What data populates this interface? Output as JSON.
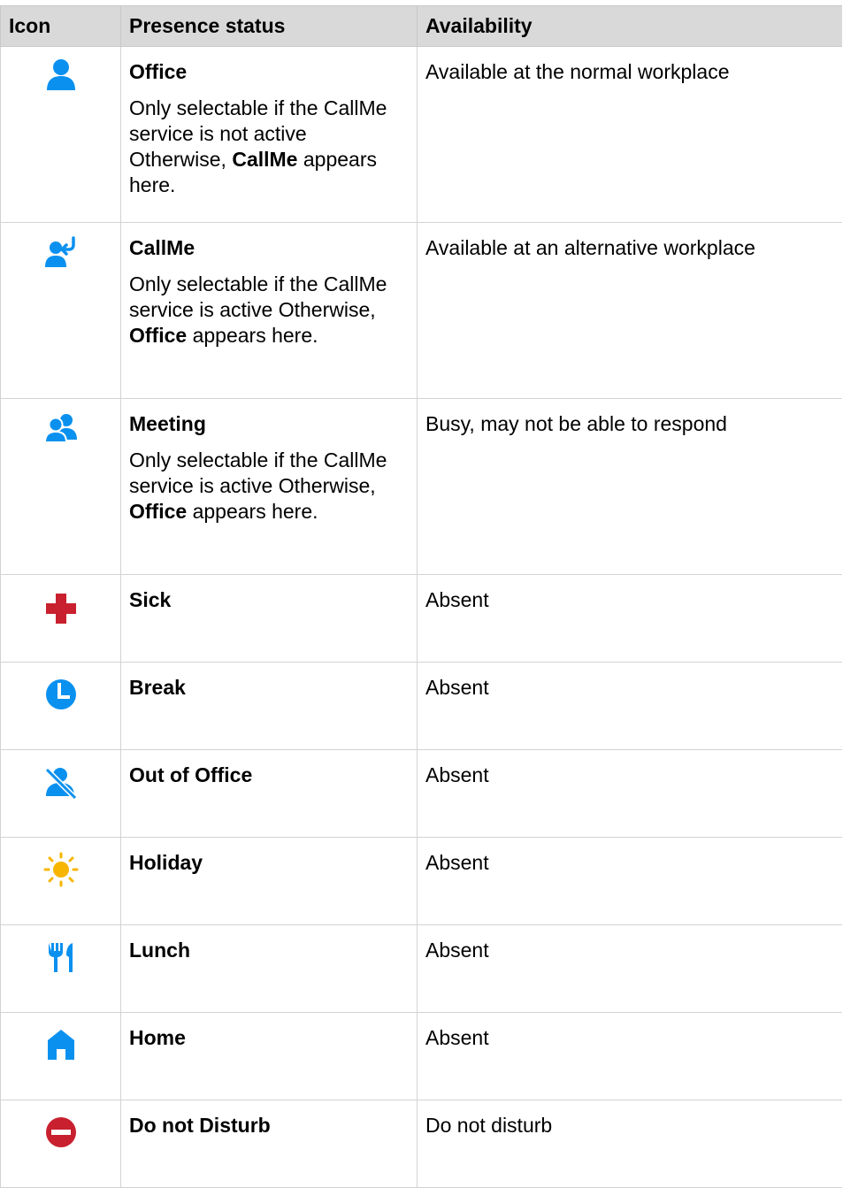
{
  "headers": {
    "icon": "Icon",
    "status": "Presence status",
    "availability": "Availability"
  },
  "colors": {
    "blue": "#0a91f0",
    "red": "#c8202e",
    "yellow": "#f7b500",
    "header_bg": "#d9d9d9"
  },
  "rows": [
    {
      "icon": "person-icon",
      "status": "Office",
      "note_before": "Only selectable if the CallMe service is not active Otherwise, ",
      "note_bold": "CallMe",
      "note_after": " appears here.",
      "availability": "Available at the normal workplace"
    },
    {
      "icon": "callme-icon",
      "status": "CallMe",
      "note_before": "Only selectable if the CallMe service is active Otherwise, ",
      "note_bold": "Office",
      "note_after": " appears here.",
      "availability": "Available at an alternative workplace"
    },
    {
      "icon": "meeting-icon",
      "status": "Meeting",
      "note_before": "Only selectable if the CallMe service is active Otherwise, ",
      "note_bold": "Office",
      "note_after": " appears here.",
      "availability": "Busy, may not be able to respond"
    },
    {
      "icon": "sick-cross-icon",
      "status": "Sick",
      "availability": "Absent"
    },
    {
      "icon": "clock-icon",
      "status": "Break",
      "availability": "Absent"
    },
    {
      "icon": "out-of-office-icon",
      "status": "Out of Office",
      "availability": "Absent"
    },
    {
      "icon": "sun-icon",
      "status": "Holiday",
      "availability": "Absent"
    },
    {
      "icon": "cutlery-icon",
      "status": "Lunch",
      "availability": "Absent"
    },
    {
      "icon": "home-icon",
      "status": "Home",
      "availability": "Absent"
    },
    {
      "icon": "do-not-disturb-icon",
      "status": "Do not Disturb",
      "availability": "Do not disturb"
    }
  ]
}
